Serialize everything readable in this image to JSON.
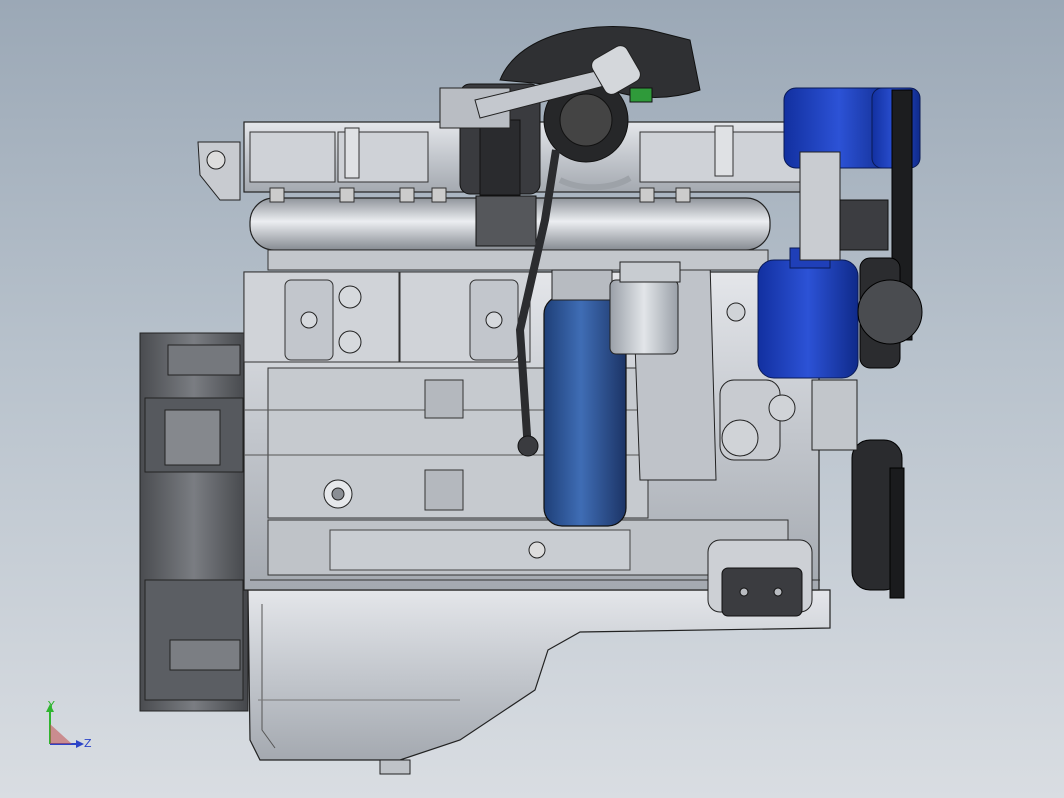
{
  "viewport": {
    "background_top": "#9ba8b6",
    "background_bottom": "#d9dde2"
  },
  "model": {
    "subject": "engine-assembly",
    "body_color": "#c8ccd2",
    "edge_color": "#2a2a2a",
    "accent_color": "#1f3fb8",
    "filter_color": "#2e5aa0",
    "flywheel_color": "#6b6e73"
  },
  "triad": {
    "y_label": "Y",
    "z_label": "Z",
    "y_color": "#2fb52f",
    "z_color": "#2c44c8"
  }
}
